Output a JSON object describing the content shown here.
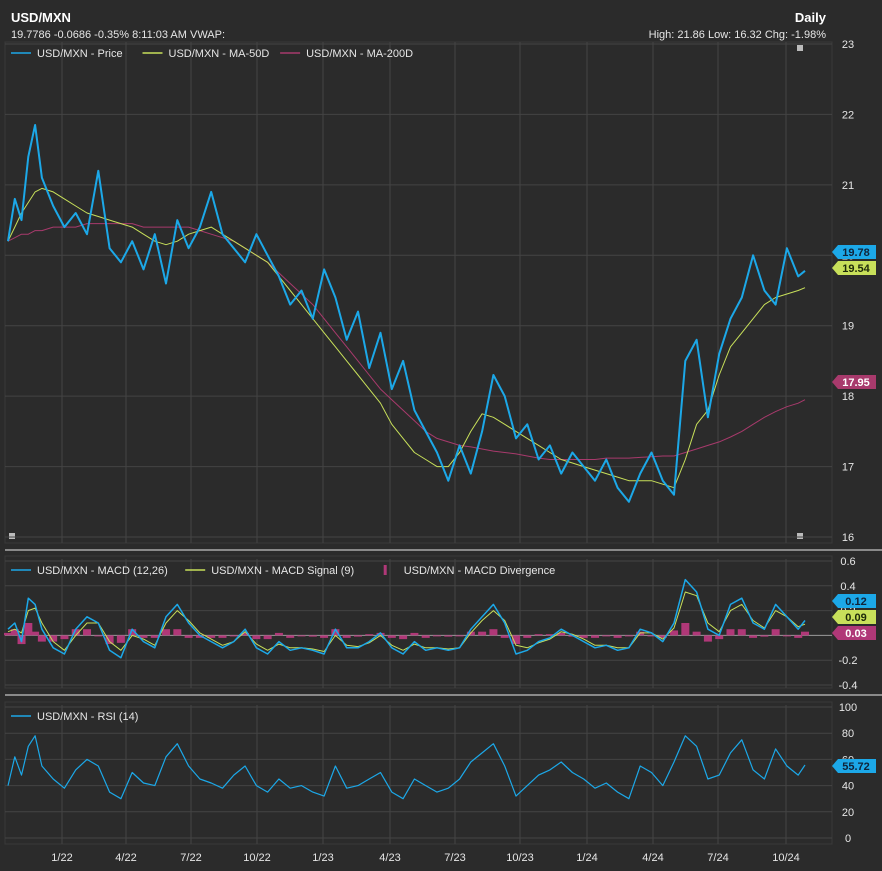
{
  "header": {
    "title": "USD/MXN",
    "frequency": "Daily",
    "quote_line": "19.7786 -0.0686 -0.35% 8:11:03 AM VWAP:",
    "stats_line": "High: 21.86 Low: 16.32 Chg: -1.98%"
  },
  "colors": {
    "background": "#2b2b2b",
    "grid": "#444444",
    "price": "#1ca8e8",
    "ma50": "#c8e05a",
    "ma200": "#a83a6c",
    "macd": "#1ca8e8",
    "signal": "#c8e05a",
    "divergence": "#b03878",
    "rsi": "#1ca8e8"
  },
  "chart_data": [
    {
      "type": "line",
      "name": "price-panel",
      "ylim": [
        16,
        23
      ],
      "y_ticks": [
        16,
        17,
        18,
        19,
        20,
        21,
        22,
        23
      ],
      "x_ticks": [
        "1/22",
        "4/22",
        "7/22",
        "10/22",
        "1/23",
        "4/23",
        "7/23",
        "10/23",
        "1/24",
        "4/24",
        "7/24",
        "10/24"
      ],
      "legend": [
        "USD/MXN - Price",
        "USD/MXN - MA-50D",
        "USD/MXN - MA-200D"
      ],
      "badges": [
        {
          "series": "price",
          "value": 19.78,
          "label": "19.78"
        },
        {
          "series": "ma50",
          "value": 19.54,
          "label": "19.54"
        },
        {
          "series": "ma200",
          "value": 17.95,
          "label": "17.95"
        }
      ],
      "x": [
        0,
        0.3,
        0.6,
        0.9,
        1.2,
        1.5,
        2,
        2.5,
        3,
        3.5,
        4,
        4.5,
        5,
        5.5,
        6,
        6.5,
        7,
        7.5,
        8,
        8.5,
        9,
        9.5,
        10,
        10.5,
        11,
        11.5,
        12,
        12.5,
        13,
        13.5,
        14,
        14.5,
        15,
        15.5,
        16,
        16.5,
        17,
        17.5,
        18,
        18.5,
        19,
        19.5,
        20,
        20.5,
        21,
        21.5,
        22,
        22.5,
        23,
        23.5,
        24,
        24.5,
        25,
        25.5,
        26,
        26.5,
        27,
        27.5,
        28,
        28.5,
        29,
        29.5,
        30,
        30.5,
        31,
        31.5,
        32,
        32.5,
        33,
        33.5,
        34,
        34.5,
        35,
        35.3
      ],
      "series": [
        {
          "name": "USD/MXN - Price",
          "values": [
            20.2,
            20.8,
            20.5,
            21.4,
            21.85,
            21.1,
            20.7,
            20.4,
            20.6,
            20.3,
            21.2,
            20.1,
            19.9,
            20.2,
            19.8,
            20.3,
            19.6,
            20.5,
            20.1,
            20.4,
            20.9,
            20.3,
            20.1,
            19.9,
            20.3,
            20.0,
            19.7,
            19.3,
            19.5,
            19.1,
            19.8,
            19.4,
            18.8,
            19.2,
            18.4,
            18.9,
            18.1,
            18.5,
            17.8,
            17.5,
            17.2,
            16.8,
            17.3,
            16.9,
            17.5,
            18.3,
            18.0,
            17.4,
            17.6,
            17.1,
            17.3,
            16.9,
            17.2,
            17.0,
            16.8,
            17.1,
            16.7,
            16.5,
            16.9,
            17.2,
            16.8,
            16.6,
            18.5,
            18.8,
            17.7,
            18.6,
            19.1,
            19.4,
            20.0,
            19.5,
            19.3,
            20.1,
            19.7,
            19.78
          ]
        },
        {
          "name": "USD/MXN - MA-50D",
          "values": [
            20.2,
            20.4,
            20.6,
            20.75,
            20.9,
            20.95,
            20.9,
            20.8,
            20.7,
            20.6,
            20.55,
            20.5,
            20.45,
            20.4,
            20.3,
            20.2,
            20.15,
            20.2,
            20.3,
            20.35,
            20.4,
            20.3,
            20.2,
            20.1,
            20.0,
            19.9,
            19.7,
            19.5,
            19.3,
            19.1,
            18.9,
            18.7,
            18.5,
            18.3,
            18.1,
            17.9,
            17.6,
            17.4,
            17.2,
            17.1,
            17.0,
            17.0,
            17.2,
            17.5,
            17.75,
            17.7,
            17.6,
            17.5,
            17.4,
            17.3,
            17.2,
            17.1,
            17.05,
            17.0,
            16.95,
            16.9,
            16.85,
            16.8,
            16.8,
            16.8,
            16.75,
            16.7,
            17.1,
            17.6,
            17.8,
            18.3,
            18.7,
            18.9,
            19.1,
            19.3,
            19.4,
            19.45,
            19.5,
            19.54
          ]
        },
        {
          "name": "USD/MXN - MA-200D",
          "values": [
            20.2,
            20.25,
            20.3,
            20.3,
            20.35,
            20.35,
            20.4,
            20.4,
            20.4,
            20.45,
            20.45,
            20.45,
            20.45,
            20.45,
            20.4,
            20.4,
            20.4,
            20.4,
            20.4,
            20.35,
            20.3,
            20.25,
            20.2,
            20.1,
            20.0,
            19.9,
            19.75,
            19.6,
            19.45,
            19.3,
            19.1,
            18.9,
            18.7,
            18.5,
            18.3,
            18.1,
            17.95,
            17.8,
            17.65,
            17.5,
            17.4,
            17.35,
            17.3,
            17.28,
            17.25,
            17.22,
            17.2,
            17.18,
            17.15,
            17.12,
            17.1,
            17.1,
            17.1,
            17.1,
            17.1,
            17.12,
            17.12,
            17.12,
            17.13,
            17.14,
            17.15,
            17.15,
            17.2,
            17.25,
            17.3,
            17.35,
            17.42,
            17.5,
            17.6,
            17.7,
            17.78,
            17.85,
            17.9,
            17.95
          ]
        }
      ]
    },
    {
      "type": "line",
      "name": "macd-panel",
      "ylim": [
        -0.4,
        0.6
      ],
      "y_ticks": [
        -0.4,
        -0.2,
        0.2,
        0.4,
        0.6
      ],
      "legend": [
        "USD/MXN - MACD (12,26)",
        "USD/MXN - MACD Signal (9)",
        "USD/MXN - MACD Divergence"
      ],
      "badges": [
        {
          "series": "macd",
          "value": 0.12,
          "label": "0.12"
        },
        {
          "series": "signal",
          "value": 0.09,
          "label": "0.09"
        },
        {
          "series": "divergence",
          "value": 0.03,
          "label": "0.03"
        }
      ],
      "series": [
        {
          "name": "USD/MXN - MACD (12,26)",
          "values": [
            0.05,
            0.1,
            -0.05,
            0.3,
            0.25,
            0.05,
            -0.1,
            -0.15,
            0.05,
            0.15,
            0.1,
            -0.12,
            -0.18,
            0.05,
            -0.05,
            -0.1,
            0.15,
            0.25,
            0.1,
            0.0,
            -0.05,
            -0.1,
            -0.05,
            0.05,
            -0.1,
            -0.15,
            -0.05,
            -0.12,
            -0.1,
            -0.12,
            -0.15,
            0.05,
            -0.1,
            -0.1,
            -0.05,
            0.02,
            -0.1,
            -0.15,
            -0.05,
            -0.12,
            -0.1,
            -0.12,
            -0.1,
            0.05,
            0.15,
            0.25,
            0.1,
            -0.15,
            -0.12,
            -0.05,
            -0.02,
            0.05,
            0.0,
            -0.05,
            -0.1,
            -0.08,
            -0.12,
            -0.1,
            0.05,
            0.02,
            -0.05,
            0.1,
            0.45,
            0.35,
            0.05,
            0.0,
            0.25,
            0.3,
            0.1,
            0.05,
            0.25,
            0.15,
            0.05,
            0.12
          ]
        },
        {
          "name": "USD/MXN - MACD Signal (9)",
          "values": [
            0.03,
            0.05,
            0.02,
            0.2,
            0.22,
            0.1,
            -0.05,
            -0.12,
            0.0,
            0.1,
            0.1,
            -0.05,
            -0.12,
            0.0,
            -0.03,
            -0.08,
            0.1,
            0.2,
            0.12,
            0.02,
            -0.03,
            -0.08,
            -0.05,
            0.03,
            -0.07,
            -0.12,
            -0.07,
            -0.1,
            -0.1,
            -0.11,
            -0.13,
            0.0,
            -0.08,
            -0.09,
            -0.06,
            0.0,
            -0.08,
            -0.12,
            -0.07,
            -0.1,
            -0.1,
            -0.11,
            -0.1,
            0.02,
            0.12,
            0.2,
            0.12,
            -0.08,
            -0.1,
            -0.06,
            -0.03,
            0.03,
            0.01,
            -0.03,
            -0.08,
            -0.08,
            -0.1,
            -0.1,
            0.02,
            0.02,
            -0.03,
            0.06,
            0.35,
            0.32,
            0.1,
            0.03,
            0.2,
            0.25,
            0.12,
            0.06,
            0.2,
            0.15,
            0.07,
            0.09
          ]
        }
      ],
      "divergence": [
        0.02,
        0.05,
        -0.07,
        0.1,
        0.03,
        -0.05,
        -0.05,
        -0.03,
        0.05,
        0.05,
        0.0,
        -0.07,
        -0.06,
        0.05,
        -0.02,
        -0.02,
        0.05,
        0.05,
        -0.02,
        -0.02,
        -0.02,
        -0.02,
        0.0,
        0.02,
        -0.03,
        -0.03,
        0.02,
        -0.02,
        0.0,
        -0.01,
        -0.02,
        0.05,
        -0.02,
        -0.01,
        0.01,
        0.02,
        -0.02,
        -0.03,
        0.02,
        -0.02,
        0.0,
        -0.01,
        0.0,
        0.03,
        0.03,
        0.05,
        -0.02,
        -0.07,
        -0.02,
        0.01,
        0.01,
        0.02,
        -0.01,
        -0.02,
        -0.02,
        0.0,
        -0.02,
        0.0,
        0.03,
        0.0,
        -0.02,
        0.04,
        0.1,
        0.03,
        -0.05,
        -0.03,
        0.05,
        0.05,
        -0.02,
        -0.01,
        0.05,
        0.0,
        -0.02,
        0.03
      ]
    },
    {
      "type": "line",
      "name": "rsi-panel",
      "ylim": [
        0,
        100
      ],
      "y_ticks": [
        0,
        20,
        40,
        60,
        80,
        100
      ],
      "legend": [
        "USD/MXN - RSI (14)"
      ],
      "badges": [
        {
          "series": "rsi",
          "value": 55.72,
          "label": "55.72"
        }
      ],
      "series": [
        {
          "name": "USD/MXN - RSI (14)",
          "values": [
            40,
            62,
            48,
            70,
            78,
            55,
            45,
            38,
            52,
            60,
            55,
            35,
            30,
            50,
            42,
            40,
            62,
            72,
            55,
            45,
            42,
            38,
            48,
            55,
            40,
            35,
            45,
            38,
            40,
            35,
            32,
            55,
            38,
            40,
            45,
            50,
            35,
            30,
            45,
            40,
            35,
            38,
            45,
            58,
            65,
            72,
            55,
            32,
            40,
            48,
            52,
            58,
            50,
            45,
            38,
            42,
            35,
            30,
            55,
            50,
            40,
            58,
            78,
            70,
            45,
            48,
            65,
            75,
            52,
            45,
            68,
            55,
            48,
            55.72
          ]
        }
      ]
    }
  ]
}
